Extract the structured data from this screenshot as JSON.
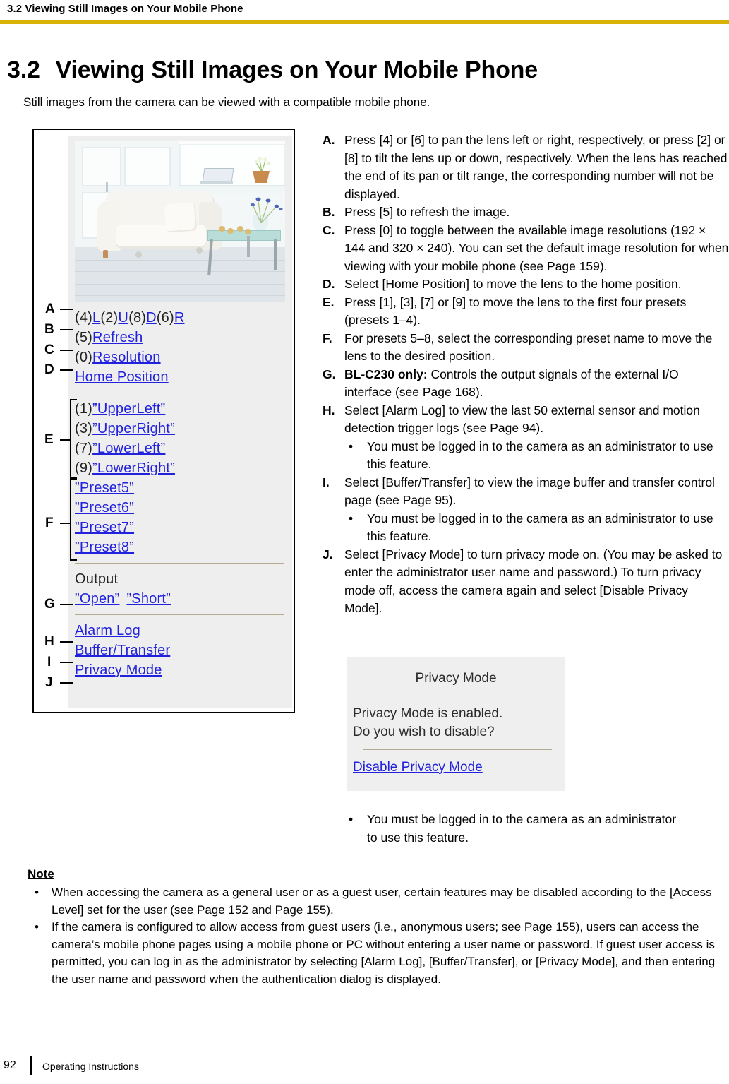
{
  "header": {
    "running_head": "3.2 Viewing Still Images on Your Mobile Phone",
    "rule_color": "#d9b206"
  },
  "section": {
    "number": "3.2",
    "title": "Viewing Still Images on Your Mobile Phone",
    "intro": "Still images from the camera can be viewed with a compatible mobile phone."
  },
  "figure": {
    "caption_letters": [
      "A",
      "B",
      "C",
      "D",
      "E",
      "F",
      "G",
      "H",
      "I",
      "J"
    ],
    "photo_alt": "Living room with white sofa, glass coffee table and windows",
    "menu": {
      "pan_row": {
        "k4": "(4)",
        "l": "L",
        "k2": "(2)",
        "u": "U",
        "k8": "(8)",
        "d": "D",
        "k6": "(6)",
        "r": "R"
      },
      "refresh": {
        "key": "(5)",
        "label": "Refresh"
      },
      "resolution": {
        "key": "(0)",
        "label": "Resolution"
      },
      "home_position": "Home Position",
      "presets_1_4": [
        {
          "key": "(1)",
          "label": "”UpperLeft”"
        },
        {
          "key": "(3)",
          "label": "”UpperRight”"
        },
        {
          "key": "(7)",
          "label": "”LowerLeft”"
        },
        {
          "key": "(9)",
          "label": "”LowerRight”"
        }
      ],
      "presets_5_8": [
        "”Preset5”",
        "”Preset6”",
        "”Preset7”",
        "”Preset8”"
      ],
      "output_label": "Output",
      "output_open": "”Open”",
      "output_short": "”Short”",
      "alarm_log": "Alarm Log",
      "buffer_transfer": "Buffer/Transfer",
      "privacy_mode": "Privacy Mode"
    }
  },
  "steps": [
    {
      "letter": "A.",
      "text": "Press [4] or [6] to pan the lens left or right, respectively, or press [2] or [8] to tilt the lens up or down, respectively. When the lens has reached the end of its pan or tilt range, the corresponding number will not be displayed."
    },
    {
      "letter": "B.",
      "text": "Press [5] to refresh the image."
    },
    {
      "letter": "C.",
      "text": "Press [0] to toggle between the available image resolutions (192 × 144 and 320 × 240). You can set the default image resolution for when viewing with your mobile phone (see Page 159)."
    },
    {
      "letter": "D.",
      "text": "Select [Home Position] to move the lens to the home position."
    },
    {
      "letter": "E.",
      "text": "Press [1], [3], [7] or [9] to move the lens to the first four presets (presets 1–4)."
    },
    {
      "letter": "F.",
      "text": "For presets 5–8, select the corresponding preset name to move the lens to the desired position."
    },
    {
      "letter": "G.",
      "bold_lead": "BL-C230 only:",
      "text": " Controls the output signals of the external I/O interface (see Page 168)."
    },
    {
      "letter": "H.",
      "text": "Select [Alarm Log] to view the last 50 external sensor and motion detection trigger logs (see Page 94).",
      "sub_bullets": [
        "You must be logged in to the camera as an administrator to use this feature."
      ]
    },
    {
      "letter": "I.",
      "text": "Select [Buffer/Transfer] to view the image buffer and transfer control page (see Page 95).",
      "sub_bullets": [
        "You must be logged in to the camera as an administrator to use this feature."
      ]
    },
    {
      "letter": "J.",
      "text": "Select [Privacy Mode] to turn privacy mode on. (You may be asked to enter the administrator user name and password.) To turn privacy mode off, access the camera again and select [Disable Privacy Mode]."
    }
  ],
  "privacy_shot": {
    "title": "Privacy Mode",
    "message_line1": "Privacy Mode is enabled.",
    "message_line2": "Do you wish to disable?",
    "link": "Disable Privacy Mode",
    "link_color": "#2222dd"
  },
  "after_shot_bullet": {
    "bullet": "•",
    "text": "You must be logged in to the camera as an administrator to use this feature."
  },
  "note": {
    "title": "Note",
    "bullet": "•",
    "items": [
      "When accessing the camera as a general user or as a guest user, certain features may be disabled according to the [Access Level] set for the user (see Page 152 and Page 155).",
      "If the camera is configured to allow access from guest users (i.e., anonymous users; see Page 155), users can access the camera’s mobile phone pages using a mobile phone or PC without entering a user name or password. If guest user access is permitted, you can log in as the administrator by selecting [Alarm Log], [Buffer/Transfer], or [Privacy Mode], and then entering the user name and password when the authentication dialog is displayed."
    ]
  },
  "footer": {
    "page_number": "92",
    "text": "Operating Instructions"
  }
}
